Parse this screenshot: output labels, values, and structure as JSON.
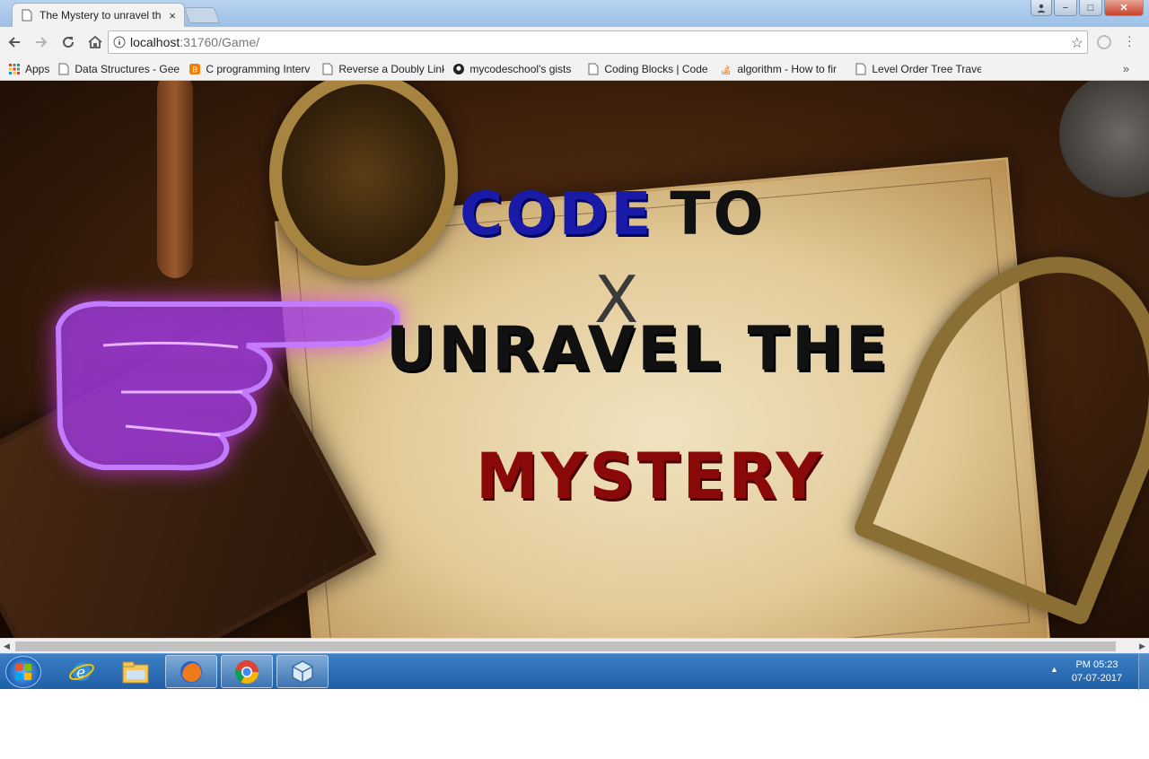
{
  "browser": {
    "tab_title": "The Mystery to unravel th",
    "tab_close": "×",
    "url_host": "localhost",
    "url_rest": ":31760/Game/",
    "window_buttons": {
      "minimize": "−",
      "maximize": "□",
      "close": "✕"
    }
  },
  "bookmarks": [
    {
      "label": "Apps",
      "icon": "apps-grid-icon"
    },
    {
      "label": "Data Structures - Gee",
      "icon": "page-icon"
    },
    {
      "label": "C programming Interv",
      "icon": "blogger-icon"
    },
    {
      "label": "Reverse a Doubly Link",
      "icon": "page-icon"
    },
    {
      "label": "mycodeschool's gists",
      "icon": "github-icon"
    },
    {
      "label": "Coding Blocks | Code",
      "icon": "page-icon"
    },
    {
      "label": "algorithm - How to fir",
      "icon": "stackoverflow-icon"
    },
    {
      "label": "Level Order Tree Trave",
      "icon": "page-icon"
    }
  ],
  "bookmarks_more": "»",
  "game": {
    "headline_word1": "CODE",
    "headline_word2": "TO",
    "headline_x": "X",
    "headline_line2": "UNRAVEL THE",
    "headline_line3": "MYSTERY",
    "colors": {
      "code": "#1a1aa8",
      "black": "#111111",
      "mystery": "#8a0a0a",
      "hand_glow": "#d83bff"
    }
  },
  "taskbar": {
    "apps": [
      "internet-explorer-icon",
      "file-explorer-icon",
      "firefox-icon",
      "chrome-icon",
      "virtualbox-icon"
    ],
    "time": "PM 05:23",
    "date": "07-07-2017",
    "tray_arrow": "▲"
  }
}
